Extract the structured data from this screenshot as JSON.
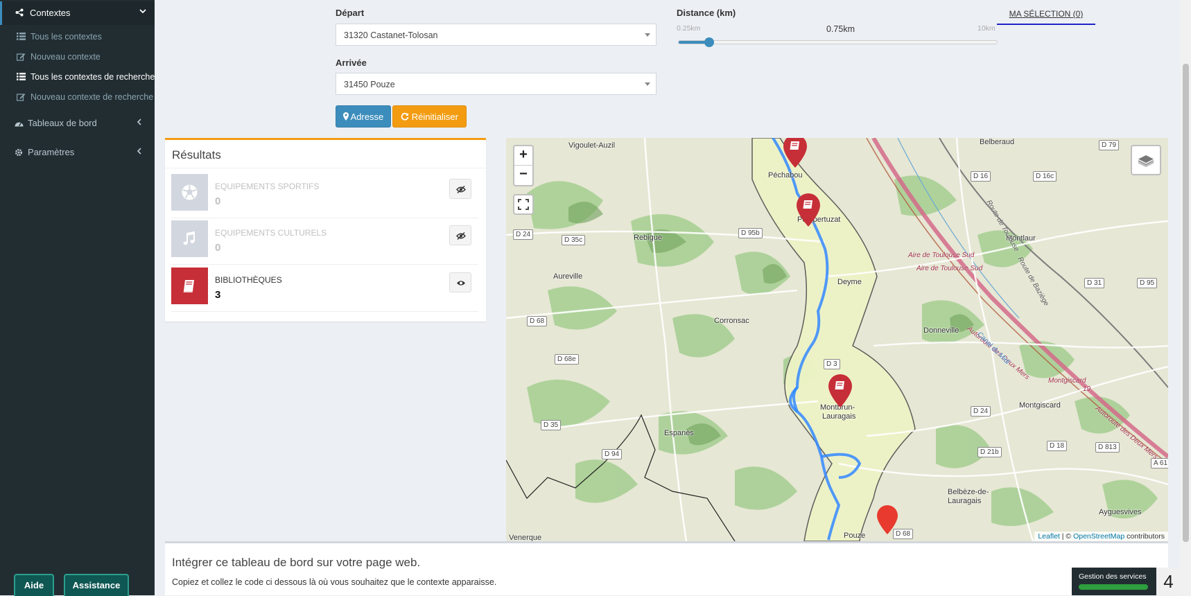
{
  "sidebar": {
    "header": {
      "label": "Contextes"
    },
    "subitems": [
      {
        "label": "Tous les contextes",
        "active": false
      },
      {
        "label": "Nouveau contexte",
        "active": false
      },
      {
        "label": "Tous les contextes de recherche",
        "active": true
      },
      {
        "label": "Nouveau contexte de recherche",
        "active": false
      }
    ],
    "items": [
      {
        "label": "Tableaux de bord"
      },
      {
        "label": "Paramètres"
      }
    ],
    "help_label": "Aide",
    "assistance_label": "Assistance"
  },
  "form": {
    "depart_label": "Départ",
    "depart_value": "31320 Castanet-Tolosan",
    "arrivee_label": "Arrivée",
    "arrivee_value": "31450 Pouze",
    "address_button": "Adresse",
    "reset_button": "Réinitialiser"
  },
  "distance": {
    "label": "Distance (km)",
    "min_label": "0.25km",
    "max_label": "10km",
    "value_label": "0.75km",
    "min": 0.25,
    "max": 10,
    "value": 0.75
  },
  "selection_tab": "MA SÉLECTION (0)",
  "results": {
    "title": "Résultats",
    "items": [
      {
        "name": "EQUIPEMENTS SPORTIFS",
        "count": "0",
        "icon": "soccer-ball-icon",
        "active": false
      },
      {
        "name": "EQUIPEMENTS CULTURELS",
        "count": "0",
        "icon": "music-note-icon",
        "active": false
      },
      {
        "name": "BIBLIOTHÈQUES",
        "count": "3",
        "icon": "book-icon",
        "active": true
      }
    ]
  },
  "map": {
    "zoom_in": "+",
    "zoom_out": "−",
    "attribution_leaflet": "Leaflet",
    "attribution_sep": " | © ",
    "attribution_osm": "OpenStreetMap",
    "attribution_tail": " contributors",
    "places": [
      "Vigoulet-Auzil",
      "Péchabou",
      "Pompertuzat",
      "Rebigue",
      "Aureville",
      "Deyme",
      "Corronsac",
      "Donneville",
      "Montbrun-",
      "Lauragais",
      "Espanès",
      "Montlaur",
      "Montgiscard",
      "Belbèze-de-",
      "Lauragais",
      "Ayguesvives",
      "Belberaud",
      "Pouze",
      "Venerque"
    ],
    "roads": [
      "D 24",
      "D 35c",
      "D 95b",
      "D 68",
      "D 68e",
      "D 35",
      "D 94",
      "D 79",
      "D 16",
      "D 16c",
      "D 31",
      "D 95",
      "D 24",
      "D 21b",
      "D 18",
      "D 813",
      "A 61",
      "D 68",
      "D 3"
    ],
    "highway_labels": [
      "Aire de Toulouse Sud",
      "Aire de Toulouse Sud",
      "Montgiscard",
      "19",
      "Autoroute des Deux Mers",
      "Autoroute des Deux Mers",
      "Route de Toulouse",
      "Route de Baziège",
      "Canal du Midi"
    ],
    "marker_color": "#c62f37"
  },
  "embed": {
    "title": "Intégrer ce tableau de bord sur votre page web.",
    "description": "Copiez et collez le code ci dessous là où vous souhaitez que le contexte apparaisse."
  },
  "gestion": {
    "label": "Gestion des services",
    "number": "4"
  },
  "colors": {
    "sidebar_bg": "#222d32",
    "accent_blue": "#3c8dbc",
    "accent_orange": "#f39c12",
    "marker_red": "#c62f37"
  }
}
